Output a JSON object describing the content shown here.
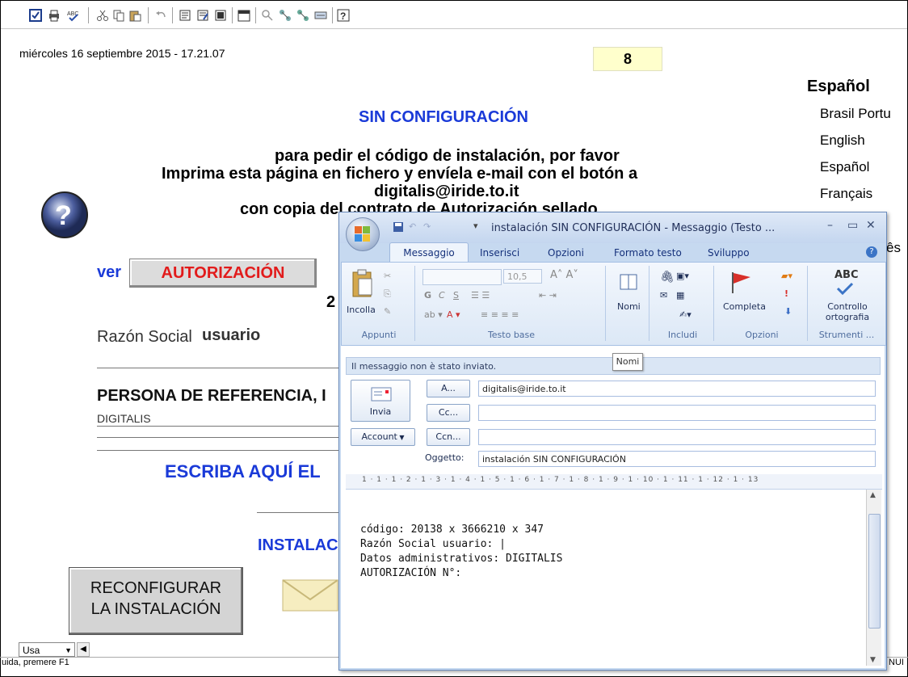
{
  "document": {
    "date_text": "miércoles 16 septiembre 2015 - 17.21.07",
    "page_number": "8",
    "title": "SIN CONFIGURACIÓN",
    "instructions": [
      "para pedir el código de instalación, por favor",
      "Imprima esta página en fichero y envíela e-mail con el botón a",
      "digitalis@iride.to.it",
      "con copia del contrato de Autorización sellado"
    ],
    "ver_label": "ver",
    "authorization_button": "AUTORIZACIÓN",
    "number_fragment": "2",
    "razon_label": "Razón Social",
    "razon_value": "usuario",
    "persona_label": "PERSONA DE REFERENCIA, I",
    "digitalis_text": "DIGITALIS",
    "escriba_text": "ESCRIBA AQUÍ EL",
    "instala_text": "INSTALAC",
    "reconfigure_button": "RECONFIGURAR\nLA INSTALACIÓN"
  },
  "languages": {
    "heading": "Español",
    "items": [
      "Brasil Portu",
      "English",
      "Español",
      "Français"
    ],
    "partial_item": "ês"
  },
  "statusbar": {
    "combo_value": "Usa",
    "help_text": "uida, premere F1",
    "right_text": "NUI"
  },
  "email_window": {
    "title": "instalación SIN CONFIGURACIÓN - Messaggio (Testo ...",
    "tabs": [
      "Messaggio",
      "Inserisci",
      "Opzioni",
      "Formato testo",
      "Sviluppo"
    ],
    "ribbon": {
      "paste_label": "Incolla",
      "font_size": "10,5",
      "names_label": "Nomi",
      "complete_label": "Completa",
      "spellcheck_label": "Controllo ortografia",
      "abc": "ABC",
      "groups": [
        "Appunti",
        "Testo base",
        "Includi",
        "Opzioni",
        "Strumenti ..."
      ]
    },
    "info_message": "Il messaggio non è stato inviato.",
    "tooltip": "Nomi",
    "send_label": "Invia",
    "to_button": "A...",
    "cc_button": "Cc...",
    "bcc_button": "Ccn...",
    "account_button": "Account",
    "subject_label": "Oggetto:",
    "to_value": "digitalis@iride.to.it",
    "cc_value": "",
    "bcc_value": "",
    "subject_value": "instalación SIN CONFIGURACIÓN",
    "ruler_text": "1 · 1 · 1 · 2 · 1 · 3 · 1 · 4 · 1 · 5 · 1 · 6 · 1 · 7 · 1 · 8 · 1 · 9 · 1 · 10 · 1 · 11 · 1 · 12 · 1 · 13",
    "body_lines": [
      "código: 20138 x 3666210 x 347",
      "Razón Social usuario: |",
      "Datos administrativos: DIGITALIS",
      "AUTORIZACIÓN N°:"
    ]
  },
  "colors": {
    "accent_blue": "#1a3ad8",
    "alert_red": "#e21b1b",
    "page_yellow": "#ffffcc",
    "outlook_frame": "#c6d9f0"
  }
}
